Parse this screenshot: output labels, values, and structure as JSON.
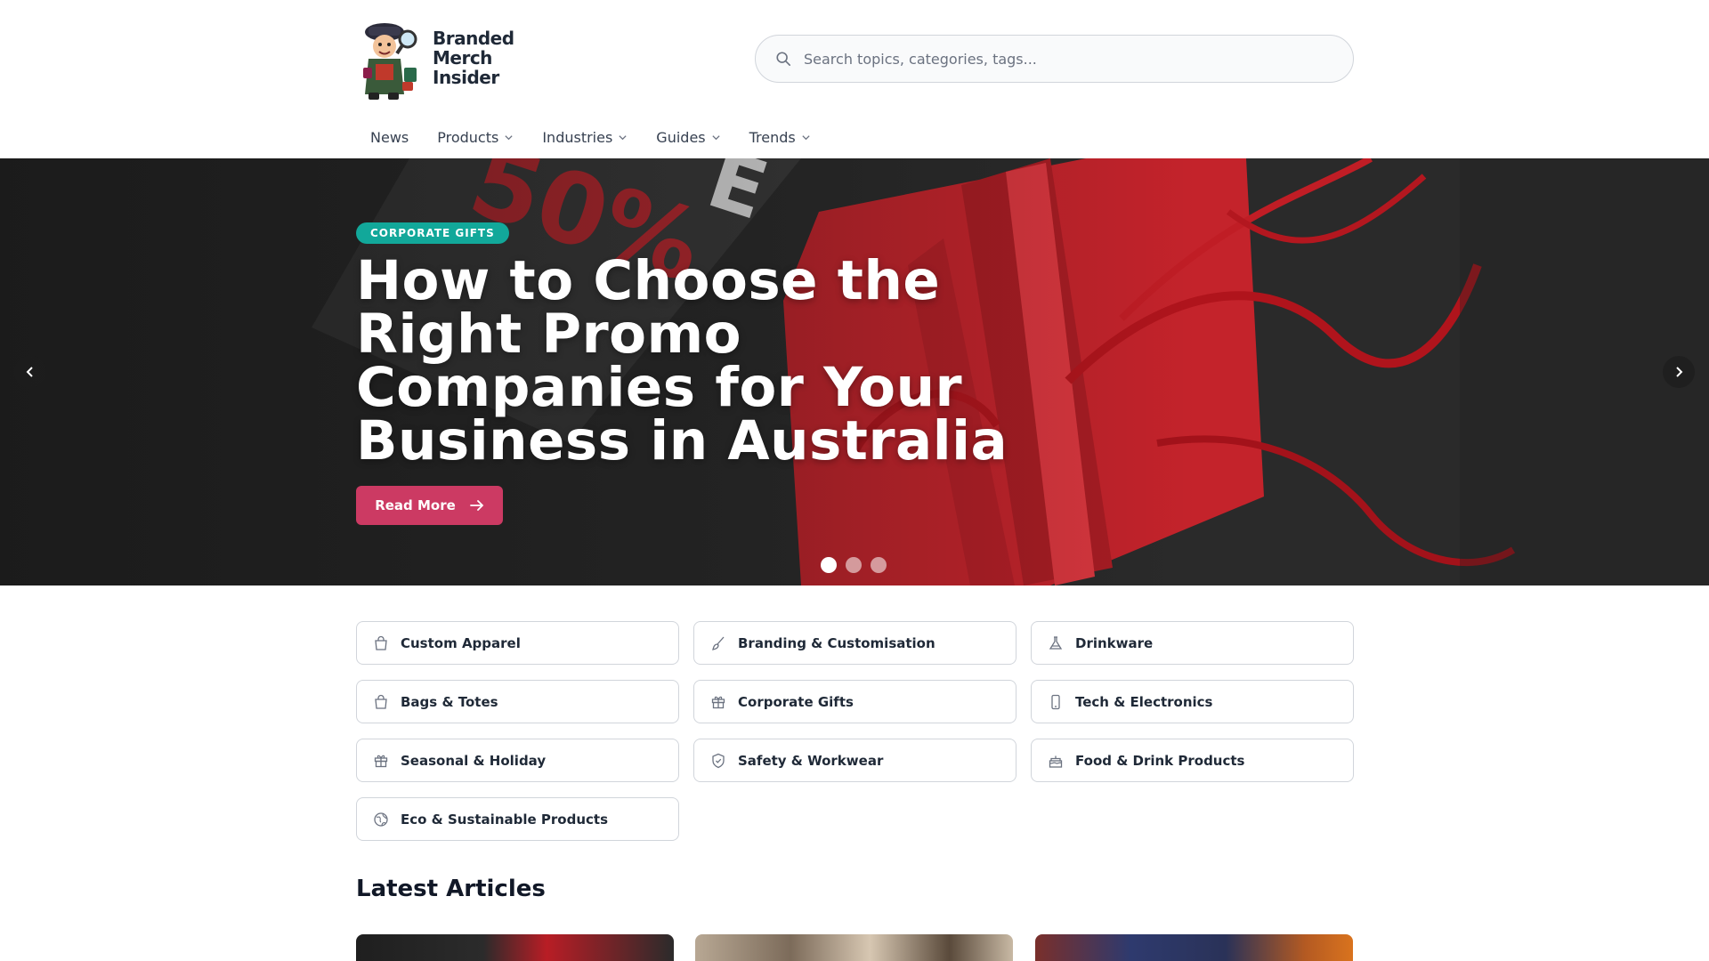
{
  "brand": {
    "logo_lines": [
      "Branded",
      "Merch",
      "Insider"
    ]
  },
  "search": {
    "placeholder": "Search topics, categories, tags..."
  },
  "nav": {
    "items": [
      {
        "label": "News",
        "has_dropdown": false
      },
      {
        "label": "Products",
        "has_dropdown": true
      },
      {
        "label": "Industries",
        "has_dropdown": true
      },
      {
        "label": "Guides",
        "has_dropdown": true
      },
      {
        "label": "Trends",
        "has_dropdown": true
      }
    ]
  },
  "hero": {
    "badge": "CORPORATE GIFTS",
    "title": "How to Choose the Right Promo Companies for Your Business in Australia",
    "cta_label": "Read More",
    "slide_count": 3,
    "active_slide": 1,
    "badge_color": "#12a89a",
    "cta_color": "#cc3a63"
  },
  "categories": [
    {
      "label": "Custom Apparel",
      "icon": "shopping-bag-icon"
    },
    {
      "label": "Branding & Customisation",
      "icon": "brush-icon"
    },
    {
      "label": "Drinkware",
      "icon": "flask-icon"
    },
    {
      "label": "Bags & Totes",
      "icon": "shopping-bag-icon"
    },
    {
      "label": "Corporate Gifts",
      "icon": "gift-icon"
    },
    {
      "label": "Tech & Electronics",
      "icon": "smartphone-icon"
    },
    {
      "label": "Seasonal & Holiday",
      "icon": "gift-icon"
    },
    {
      "label": "Safety & Workwear",
      "icon": "shield-icon"
    },
    {
      "label": "Food & Drink Products",
      "icon": "cake-icon"
    },
    {
      "label": "Eco & Sustainable Products",
      "icon": "globe-leaf-icon"
    }
  ],
  "latest": {
    "title": "Latest Articles"
  }
}
